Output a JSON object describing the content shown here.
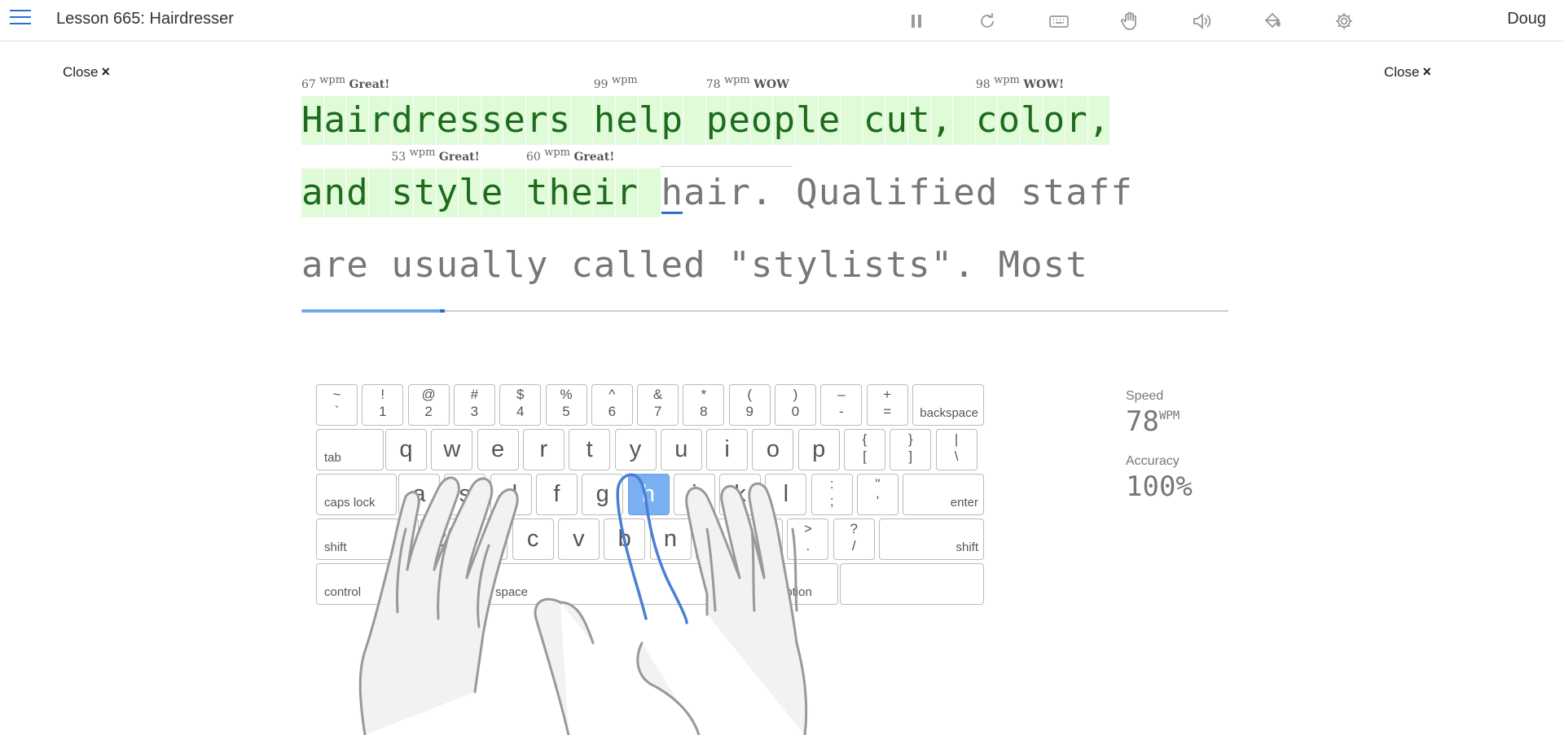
{
  "header": {
    "lesson_title": "Lesson 665: Hairdresser",
    "user": "Doug",
    "icons": [
      "pause-icon",
      "restart-icon",
      "keyboard-icon",
      "hand-icon",
      "sound-icon",
      "paint-bucket-icon",
      "gear-icon"
    ]
  },
  "close_label": "Close",
  "close_glyph": "×",
  "lines": [
    [
      {
        "text": "Hairdressers",
        "state": "typed",
        "wpm": "67",
        "badge": "Great!"
      },
      {
        "text": "help",
        "state": "typed",
        "wpm": "99",
        "badge": ""
      },
      {
        "text": "people",
        "state": "typed",
        "wpm": "78",
        "badge": "WOW"
      },
      {
        "text": "cut,",
        "state": "typed"
      },
      {
        "text": "color,",
        "state": "typed",
        "wpm": "98",
        "badge": "WOW!"
      }
    ],
    [
      {
        "text": "and",
        "state": "typed"
      },
      {
        "text": "style",
        "state": "typed",
        "wpm": "53",
        "badge": "Great!"
      },
      {
        "text": "their",
        "state": "typed",
        "wpm": "60",
        "badge": "Great!"
      },
      {
        "text": "hair.",
        "state": "current"
      },
      {
        "text": "Qualified",
        "state": "pending"
      },
      {
        "text": "staff",
        "state": "pending"
      }
    ],
    [
      {
        "text": "are",
        "state": "pending"
      },
      {
        "text": "usually",
        "state": "pending"
      },
      {
        "text": "called",
        "state": "pending"
      },
      {
        "text": "\"stylists\".",
        "state": "pending"
      },
      {
        "text": "Most",
        "state": "pending"
      }
    ]
  ],
  "wpm_unit": "wpm",
  "progress_fraction": 0.155,
  "keyboard": {
    "row1": [
      [
        "~",
        "`"
      ],
      [
        "!",
        "1"
      ],
      [
        "@",
        "2"
      ],
      [
        "#",
        "3"
      ],
      [
        "$",
        "4"
      ],
      [
        "%",
        "5"
      ],
      [
        "^",
        "6"
      ],
      [
        "&",
        "7"
      ],
      [
        "*",
        "8"
      ],
      [
        "(",
        "9"
      ],
      [
        ")",
        "0"
      ],
      [
        "–",
        "-"
      ],
      [
        "+",
        "="
      ]
    ],
    "row2": [
      "q",
      "w",
      "e",
      "r",
      "t",
      "y",
      "u",
      "i",
      "o",
      "p"
    ],
    "row2_extra": [
      [
        "{",
        "["
      ],
      [
        "}",
        "]"
      ],
      [
        "|",
        "\\"
      ]
    ],
    "row3": [
      "a",
      "s",
      "d",
      "f",
      "g",
      "h",
      "j",
      "k",
      "l"
    ],
    "row3_extra": [
      [
        ":",
        ";"
      ],
      [
        "\"",
        "'"
      ]
    ],
    "row4": [
      "z",
      "x",
      "c",
      "v",
      "b",
      "n",
      "m"
    ],
    "row4_extra": [
      [
        "<",
        ","
      ],
      [
        ">",
        "."
      ],
      [
        "?",
        "/"
      ]
    ],
    "labels": {
      "backspace": "backspace",
      "tab": "tab",
      "caps": "caps lock",
      "enter": "enter",
      "shift": "shift",
      "control": "control",
      "option": "option",
      "space": "space"
    },
    "active_key": "h"
  },
  "stats": {
    "speed_label": "Speed",
    "speed_value": "78",
    "speed_unit": "WPM",
    "accuracy_label": "Accuracy",
    "accuracy_value": "100%"
  }
}
